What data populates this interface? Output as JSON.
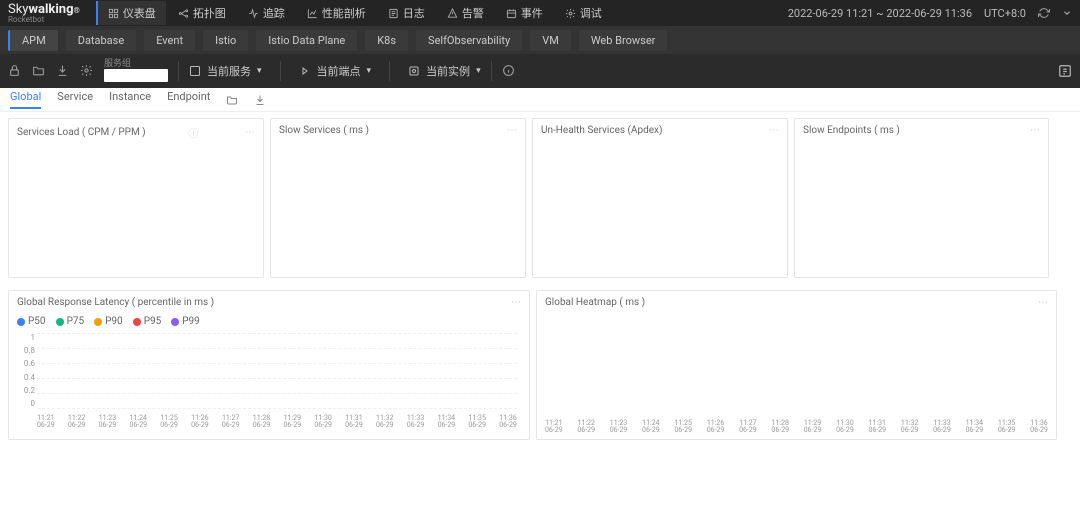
{
  "header": {
    "logo_main_pre": "Sky",
    "logo_main_bold": "walking",
    "logo_sub": "Rocketbot",
    "time_range": "2022-06-29 11:21 ~ 2022-06-29 11:36",
    "tz": "UTC+8:0",
    "nav": [
      {
        "label": "仪表盘",
        "icon": "dashboard",
        "active": true
      },
      {
        "label": "拓扑图",
        "icon": "topology"
      },
      {
        "label": "追踪",
        "icon": "trace"
      },
      {
        "label": "性能剖析",
        "icon": "profile"
      },
      {
        "label": "日志",
        "icon": "log"
      },
      {
        "label": "告警",
        "icon": "alarm"
      },
      {
        "label": "事件",
        "icon": "event"
      },
      {
        "label": "调试",
        "icon": "debug"
      }
    ]
  },
  "tabs": [
    {
      "label": "APM",
      "active": true
    },
    {
      "label": "Database"
    },
    {
      "label": "Event"
    },
    {
      "label": "Istio"
    },
    {
      "label": "Istio Data Plane"
    },
    {
      "label": "K8s"
    },
    {
      "label": "SelfObservability"
    },
    {
      "label": "VM"
    },
    {
      "label": "Web Browser"
    }
  ],
  "toolbar": {
    "service_group_label": "服务组",
    "selectors": [
      {
        "label": "当前服务"
      },
      {
        "label": "当前端点"
      },
      {
        "label": "当前实例"
      }
    ]
  },
  "subtabs": [
    {
      "label": "Global",
      "active": true
    },
    {
      "label": "Service"
    },
    {
      "label": "Instance"
    },
    {
      "label": "Endpoint"
    }
  ],
  "cards": {
    "services_load": {
      "title": "Services Load ( CPM / PPM )"
    },
    "slow_services": {
      "title": "Slow Services ( ms )"
    },
    "unhealth_services": {
      "title": "Un-Health Services (Apdex)"
    },
    "slow_endpoints": {
      "title": "Slow Endpoints ( ms )"
    },
    "global_latency": {
      "title": "Global Response Latency ( percentile in ms )",
      "legend": [
        {
          "name": "P50",
          "color": "#3b82f6"
        },
        {
          "name": "P75",
          "color": "#10b981"
        },
        {
          "name": "P90",
          "color": "#f59e0b"
        },
        {
          "name": "P95",
          "color": "#ef4444"
        },
        {
          "name": "P99",
          "color": "#8b5cf6"
        }
      ]
    },
    "global_heatmap": {
      "title": "Global Heatmap ( ms )"
    }
  },
  "chart_data": {
    "type": "line",
    "title": "Global Response Latency ( percentile in ms )",
    "xlabel": "",
    "ylabel": "",
    "ylim": [
      0,
      1
    ],
    "yticks": [
      0,
      0.2,
      0.4,
      0.6,
      0.8,
      1
    ],
    "x": [
      "11:21 06-29",
      "11:22 06-29",
      "11:23 06-29",
      "11:24 06-29",
      "11:25 06-29",
      "11:26 06-29",
      "11:27 06-29",
      "11:28 06-29",
      "11:29 06-29",
      "11:30 06-29",
      "11:31 06-29",
      "11:32 06-29",
      "11:33 06-29",
      "11:34 06-29",
      "11:35 06-29",
      "11:36 06-29"
    ],
    "series": [
      {
        "name": "P50",
        "values": [
          0,
          0,
          0,
          0,
          0,
          0,
          0,
          0,
          0,
          0,
          0,
          0,
          0,
          0,
          0,
          0
        ]
      },
      {
        "name": "P75",
        "values": [
          0,
          0,
          0,
          0,
          0,
          0,
          0,
          0,
          0,
          0,
          0,
          0,
          0,
          0,
          0,
          0
        ]
      },
      {
        "name": "P90",
        "values": [
          0,
          0,
          0,
          0,
          0,
          0,
          0,
          0,
          0,
          0,
          0,
          0,
          0,
          0,
          0,
          0
        ]
      },
      {
        "name": "P95",
        "values": [
          0,
          0,
          0,
          0,
          0,
          0,
          0,
          0,
          0,
          0,
          0,
          0,
          0,
          0,
          0,
          0
        ]
      },
      {
        "name": "P99",
        "values": [
          0,
          0,
          0,
          0,
          0,
          0,
          0,
          0,
          0,
          0,
          0,
          0,
          0,
          0,
          0,
          0
        ]
      }
    ],
    "heatmap_x": [
      "11:21 06-29",
      "11:22 06-29",
      "11:23 06-29",
      "11:24 06-29",
      "11:25 06-29",
      "11:26 06-29",
      "11:27 06-29",
      "11:28 06-29",
      "11:29 06-29",
      "11:30 06-29",
      "11:31 06-29",
      "11:32 06-29",
      "11:33 06-29",
      "11:34 06-29",
      "11:35 06-29",
      "11:36 06-29"
    ]
  }
}
